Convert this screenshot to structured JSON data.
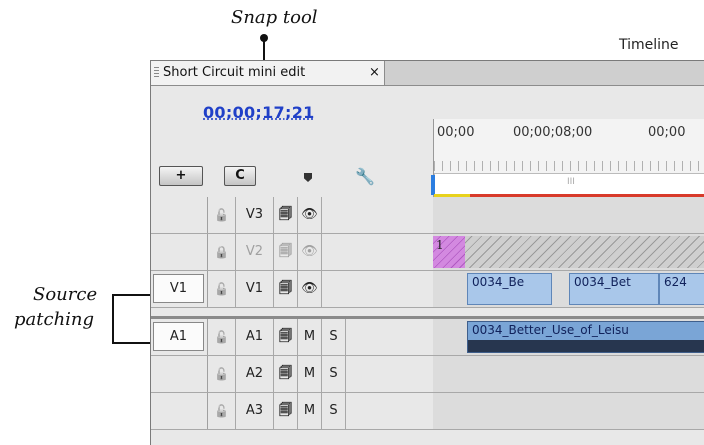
{
  "callouts": {
    "snap_tool": "Snap tool",
    "source_patching_line1": "Source",
    "source_patching_line2": "patching"
  },
  "panel_title": "Timeline",
  "sequence_tab": {
    "label": "Short Circuit mini edit",
    "close": "×"
  },
  "timecode": "00;00;17;21",
  "ruler": {
    "labels": [
      "00;00",
      "00;00;08;00",
      "00;00"
    ],
    "playbar_marker": "III"
  },
  "toolbar": {
    "snap_button_glyph": "C",
    "insert_button_glyph": "+"
  },
  "video_tracks": [
    {
      "source": "",
      "name": "V3",
      "lock": "unlocked",
      "sync": "on",
      "visible": "on",
      "dimmed": false
    },
    {
      "source": "",
      "name": "V2",
      "lock": "locked",
      "sync": "on",
      "visible": "on",
      "dimmed": true
    },
    {
      "source": "V1",
      "name": "V1",
      "lock": "unlocked",
      "sync": "on",
      "visible": "on",
      "dimmed": false
    }
  ],
  "audio_tracks": [
    {
      "source": "A1",
      "name": "A1",
      "lock": "unlocked",
      "m": "M",
      "s": "S"
    },
    {
      "source": "",
      "name": "A2",
      "lock": "unlocked",
      "m": "M",
      "s": "S"
    },
    {
      "source": "",
      "name": "A3",
      "lock": "unlocked",
      "m": "M",
      "s": "S"
    }
  ],
  "clips": {
    "v2_graphic_label": "1",
    "v1_clip1": "0034_Be",
    "v1_clip2": "0034_Bet",
    "v1_clip3": "624",
    "a1_clip": "0034_Better_Use_of_Leisu"
  },
  "colors": {
    "timecode": "#2040c8",
    "video_clip": "#a9c7ea",
    "audio_clip": "#7aa5d6",
    "graphic_clip": "#d389e0",
    "playhead_region": "#d83a2a",
    "work_area": "#e8d21c"
  }
}
